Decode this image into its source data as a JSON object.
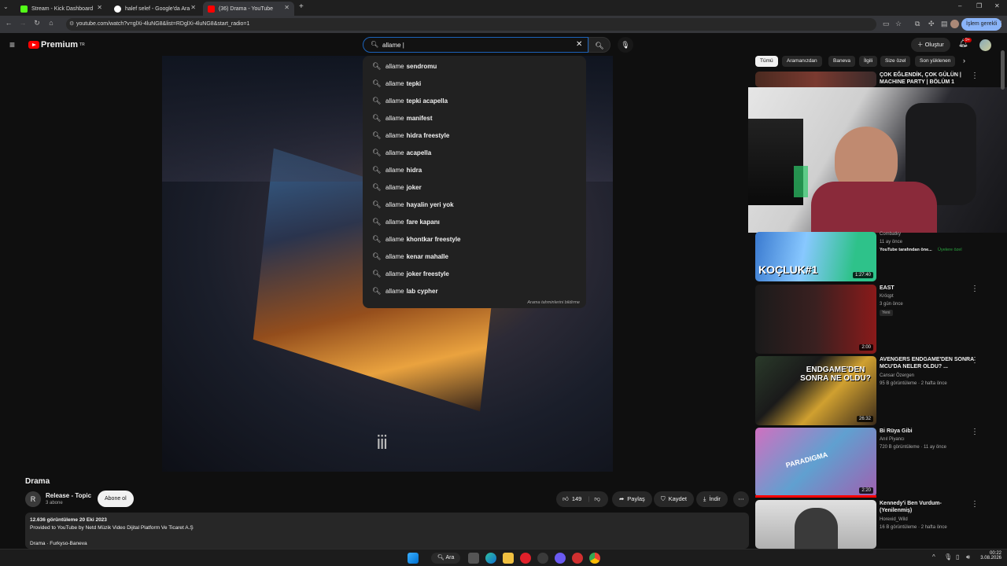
{
  "browser": {
    "tabs": [
      {
        "title": "Stream - Kick Dashboard",
        "color": "#53fc18",
        "active": false
      },
      {
        "title": "halef selef - Google'da Ara",
        "color": "#ffffff",
        "active": false
      },
      {
        "title": "(36) Drama - YouTube",
        "color": "#ff0000",
        "active": true
      }
    ],
    "new_tab_label": "+",
    "url": "youtube.com/watch?v=glXi-4luNG8&list=RDglXi-4luNG8&start_radio=1",
    "profile_label": "İşlem gerekli",
    "window_controls": [
      "–",
      "❐",
      "✕"
    ]
  },
  "youtube": {
    "logo_text": "Premium",
    "logo_region": "TR",
    "search_value": "allame |",
    "create_label": "Oluştur",
    "notification_count": "9+",
    "suggestions_prefix": "allame",
    "suggestions": [
      "sendromu",
      "tepki",
      "tepki acapella",
      "manifest",
      "hidra freestyle",
      "acapella",
      "hidra",
      "joker",
      "hayalin yeri yok",
      "fare kapanı",
      "khontkar freestyle",
      "kenar mahalle",
      "joker freestyle",
      "lab cypher"
    ],
    "report_label": "Arama tahminlerini bildirme",
    "chips": [
      "Tümü",
      "Aramanızdan",
      "Baneva",
      "İlgili",
      "Size özel",
      "Son yüklenen"
    ],
    "video": {
      "title": "Drama",
      "channel": "Release - Topic",
      "channel_initial": "R",
      "subscribers": "3 abone",
      "subscribe_label": "Abone ol",
      "likes": "149",
      "share_label": "Paylaş",
      "save_label": "Kaydet",
      "download_label": "İndir",
      "views_date": "12.636 görüntüleme  20 Eki 2023",
      "provided_by": "Provided to YouTube by Netd Müzik Video Dijital Platform Ve Ticaret A.Ş",
      "description_line": "Drama · Furkyso-Baneva"
    },
    "sidebar": [
      {
        "title": "ÇOK EĞLENDİK, ÇOK GÜLÜN | MACHINE PARTY | BÖLÜM 1",
        "channel": "",
        "meta": "",
        "duration": "",
        "badge": ""
      },
      {
        "title": "",
        "channel": "Combatky",
        "meta": "11 ay önce",
        "extra": "YouTube tarafından öne...",
        "badge2": "Üyelere özel",
        "duration": "1:27:40",
        "thumb_text": "KOÇLUK#1"
      },
      {
        "title": "EAST",
        "channel": "Kröqpt",
        "meta": "3 gün önce",
        "badge": "Yeni",
        "duration": "2:00"
      },
      {
        "title": "AVENGERS ENDGAME'DEN SONRA MCU'DA NELER OLDU? ...",
        "channel": "Cansar Özergen",
        "meta": "95 B görüntüleme · 2 hafta önce",
        "duration": "26:32",
        "thumb_text": "ENDGAME'DEN SONRA NE OLDU?"
      },
      {
        "title": "Bi Rüya Gibi",
        "channel": "Anıl Piyancı",
        "meta": "720 B görüntüleme · 11 ay önce",
        "duration": "2:20",
        "thumb_text": "PARADIGMA"
      },
      {
        "title": "Kennedy'i Ben Vurdum-(Yenilenmiş)",
        "channel": "Horexid_Wild",
        "meta": "16 B görüntüleme · 2 hafta önce",
        "duration": ""
      }
    ]
  },
  "taskbar": {
    "search_label": "Ara",
    "time": "00:22",
    "date": "3.08.2026"
  }
}
